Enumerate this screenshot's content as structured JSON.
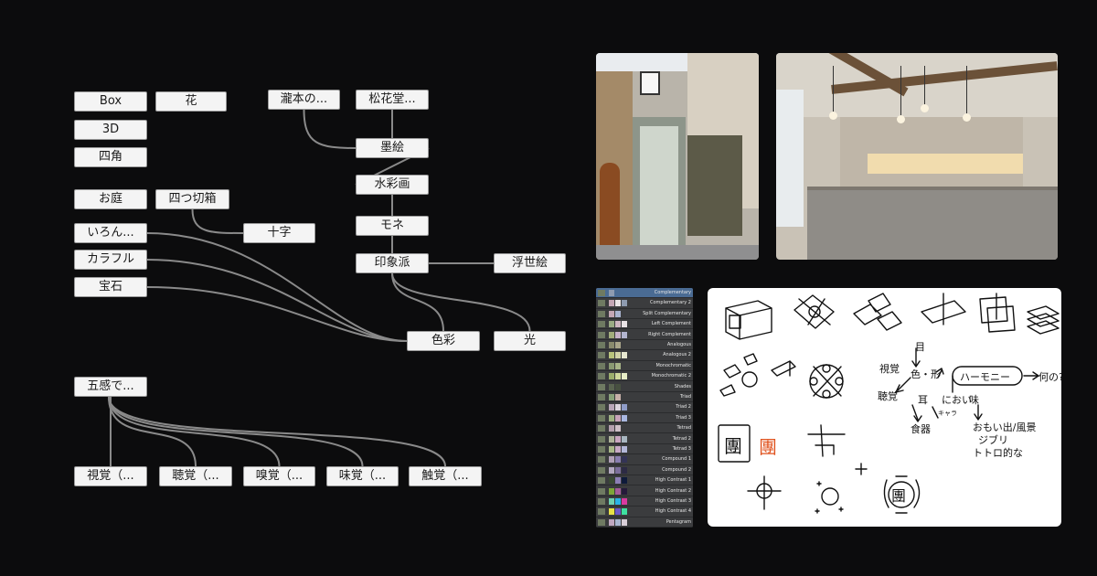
{
  "mindmap": {
    "nodes": [
      {
        "id": "box",
        "label": "Box"
      },
      {
        "id": "hana",
        "label": "花"
      },
      {
        "id": "takimoto",
        "label": "瀧本の..."
      },
      {
        "id": "shokado",
        "label": "松花堂..."
      },
      {
        "id": "3d",
        "label": "3D"
      },
      {
        "id": "sumie",
        "label": "墨絵"
      },
      {
        "id": "shikaku",
        "label": "四角"
      },
      {
        "id": "suisaiga",
        "label": "水彩画"
      },
      {
        "id": "oniwa",
        "label": "お庭"
      },
      {
        "id": "yotsukiribako",
        "label": "四つ切箱"
      },
      {
        "id": "monet",
        "label": "モネ"
      },
      {
        "id": "iron",
        "label": "いろん..."
      },
      {
        "id": "juji",
        "label": "十字"
      },
      {
        "id": "colorful",
        "label": "カラフル"
      },
      {
        "id": "inshoha",
        "label": "印象派"
      },
      {
        "id": "ukiyoe",
        "label": "浮世絵"
      },
      {
        "id": "hoseki",
        "label": "宝石"
      },
      {
        "id": "shikisai",
        "label": "色彩"
      },
      {
        "id": "hikari",
        "label": "光"
      },
      {
        "id": "gokan",
        "label": "五感で..."
      },
      {
        "id": "shikaku2",
        "label": "視覚（..."
      },
      {
        "id": "chokaku",
        "label": "聴覚（..."
      },
      {
        "id": "kyukaku",
        "label": "嗅覚（..."
      },
      {
        "id": "mikaku",
        "label": "味覚（..."
      },
      {
        "id": "shokkaku",
        "label": "触覚（..."
      }
    ],
    "edges": [
      [
        "takimoto",
        "sumie"
      ],
      [
        "shokado",
        "sumie"
      ],
      [
        "sumie",
        "suisaiga"
      ],
      [
        "suisaiga",
        "monet"
      ],
      [
        "monet",
        "inshoha"
      ],
      [
        "inshoha",
        "ukiyoe"
      ],
      [
        "inshoha",
        "shikisai"
      ],
      [
        "inshoha",
        "hikari"
      ],
      [
        "yotsukiribako",
        "juji"
      ],
      [
        "iron",
        "shikisai"
      ],
      [
        "colorful",
        "shikisai"
      ],
      [
        "hoseki",
        "shikisai"
      ],
      [
        "gokan",
        "shikaku2"
      ],
      [
        "gokan",
        "chokaku"
      ],
      [
        "gokan",
        "kyukaku"
      ],
      [
        "gokan",
        "mikaku"
      ],
      [
        "gokan",
        "shokkaku"
      ]
    ],
    "line_color": "#8a8a8a"
  },
  "palette": {
    "selected_index": 0,
    "items": [
      {
        "label": "Complementary",
        "colors": [
          "#6f7a62",
          "#8e9bb0"
        ]
      },
      {
        "label": "Complementary 2",
        "colors": [
          "#6f7a62",
          "#c4a7b5",
          "#e9e4e6",
          "#8e9bb0"
        ]
      },
      {
        "label": "Split Complementary",
        "colors": [
          "#6f7a62",
          "#c4a7b5",
          "#a9b3cf"
        ]
      },
      {
        "label": "Left Complement",
        "colors": [
          "#6f7a62",
          "#9aab84",
          "#cdb6c0",
          "#e9e3e6"
        ]
      },
      {
        "label": "Right Complement",
        "colors": [
          "#6f7a62",
          "#a2ad7c",
          "#c6b2c8",
          "#b2b4cf"
        ]
      },
      {
        "label": "Analogous",
        "colors": [
          "#6f7a62",
          "#8a8b6e",
          "#a9a58a"
        ]
      },
      {
        "label": "Analogous 2",
        "colors": [
          "#6f7a62",
          "#b9c47c",
          "#d1d3a8",
          "#e7e8d0"
        ]
      },
      {
        "label": "Monochromatic",
        "colors": [
          "#6f7a62",
          "#8a9a72",
          "#a7b487"
        ]
      },
      {
        "label": "Monochromatic 2",
        "colors": [
          "#6f7a62",
          "#9cae6c",
          "#cfd89b",
          "#e7edc6"
        ]
      },
      {
        "label": "Shades",
        "colors": [
          "#6f7a62",
          "#5a6450",
          "#475040"
        ]
      },
      {
        "label": "Triad",
        "colors": [
          "#6f7a62",
          "#8aa17a",
          "#c7b0a8"
        ]
      },
      {
        "label": "Triad 2",
        "colors": [
          "#6f7a62",
          "#b9a6b8",
          "#dcd4dd",
          "#8f9cc8"
        ]
      },
      {
        "label": "Triad 3",
        "colors": [
          "#6f7a62",
          "#9eb083",
          "#c7a3b8",
          "#a9b7e0"
        ]
      },
      {
        "label": "Tetrad",
        "colors": [
          "#6f7a62",
          "#b4a0ae",
          "#cfc0c8"
        ]
      },
      {
        "label": "Tetrad 2",
        "colors": [
          "#6f7a62",
          "#aeb39a",
          "#c9a6c0",
          "#a8b6c0"
        ]
      },
      {
        "label": "Tetrad 3",
        "colors": [
          "#6f7a62",
          "#a9b889",
          "#c7a9c5",
          "#b3b7d8"
        ]
      },
      {
        "label": "Compound 1",
        "colors": [
          "#6f7a62",
          "#b0a0b6",
          "#8a7fb0",
          "#333355"
        ]
      },
      {
        "label": "Compound 2",
        "colors": [
          "#6f7a62",
          "#b3a8c0",
          "#7d6f9c",
          "#2c2a44"
        ]
      },
      {
        "label": "High Contrast 1",
        "colors": [
          "#6f7a62",
          "#3a4a34",
          "#8d7fb6",
          "#0e1a3a"
        ]
      },
      {
        "label": "High Contrast 2",
        "colors": [
          "#6f7a62",
          "#7ea538",
          "#a55d9a",
          "#251a3a"
        ]
      },
      {
        "label": "High Contrast 3",
        "colors": [
          "#6f7a62",
          "#6fd0b0",
          "#2ab2e6",
          "#d83aa0"
        ]
      },
      {
        "label": "High Contrast 4",
        "colors": [
          "#6f7a62",
          "#e7e047",
          "#6d58c9",
          "#3ee0a0"
        ]
      },
      {
        "label": "Pentagram",
        "colors": [
          "#6f7a62",
          "#c0a8c0",
          "#a8b6d0",
          "#d9cfd8"
        ]
      }
    ]
  },
  "sketch": {
    "notes": [
      {
        "id": "me",
        "text": "目"
      },
      {
        "id": "iro-katachi",
        "text": "色・形"
      },
      {
        "id": "shikaku-note",
        "text": "視覚"
      },
      {
        "id": "harmony",
        "text": "ハーモニー"
      },
      {
        "id": "nanno",
        "text": "何の?"
      },
      {
        "id": "chokaku-note",
        "text": "聴覚"
      },
      {
        "id": "mimi",
        "text": "耳"
      },
      {
        "id": "nioi",
        "text": "におい"
      },
      {
        "id": "aji",
        "text": "味"
      },
      {
        "id": "shoku",
        "text": "食器"
      },
      {
        "id": "kyara",
        "text": "キャラ"
      },
      {
        "id": "omoide",
        "text": "おもい出/風景"
      },
      {
        "id": "ghibli",
        "text": "ジブリ"
      },
      {
        "id": "totoro",
        "text": "トトロ的な"
      },
      {
        "id": "dan-red",
        "text": "團"
      },
      {
        "id": "dan-1",
        "text": "團"
      },
      {
        "id": "dan-2",
        "text": "團"
      }
    ]
  }
}
